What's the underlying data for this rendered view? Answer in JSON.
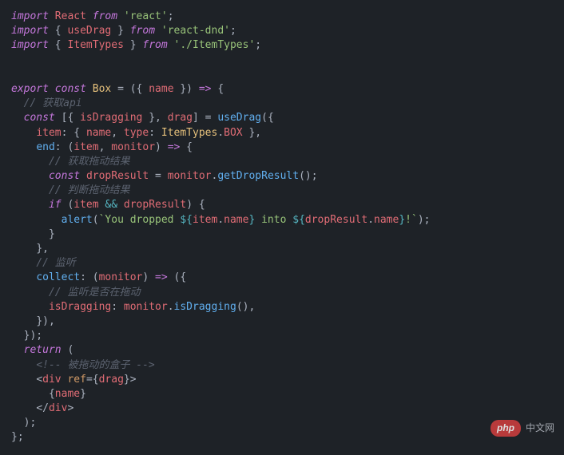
{
  "code": {
    "l1": {
      "kw1": "import",
      "name": "React",
      "kw2": "from",
      "str": "'react'",
      "end": ";"
    },
    "l2": {
      "kw1": "import",
      "br": "{ ",
      "name": "useDrag",
      "br2": " }",
      "kw2": "from",
      "str": "'react-dnd'",
      "end": ";"
    },
    "l3": {
      "kw1": "import",
      "br": "{ ",
      "name": "ItemTypes",
      "br2": " }",
      "kw2": "from",
      "str": "'./ItemTypes'",
      "end": ";"
    },
    "l4": {
      "txt": ""
    },
    "l5": {
      "txt": ""
    },
    "l6": {
      "kw1": "export",
      "kw2": "const",
      "type": "Box",
      "eq": " = ",
      "args": "({ ",
      "name": "name",
      "args2": " }) ",
      "arrow": "=>",
      "brace": " {"
    },
    "l7": {
      "com": "// 获取api"
    },
    "l8": {
      "kw": "const",
      "br": " [{ ",
      "p": "isDragging",
      "br2": " }, ",
      "p2": "drag",
      "br3": "] = ",
      "fn": "useDrag",
      "paren": "({"
    },
    "l9": {
      "p": "item",
      "colon": ": { ",
      "p2": "name",
      "comma": ", ",
      "p3": "type",
      "colon2": ": ",
      "type": "ItemTypes",
      "dot": ".",
      "prop": "BOX",
      "end": " },"
    },
    "l10": {
      "fn": "end",
      "colon": ": (",
      "a1": "item",
      "comma": ", ",
      "a2": "monitor",
      "paren": ") ",
      "arrow": "=>",
      "brace": " {"
    },
    "l11": {
      "com": "// 获取拖动结果"
    },
    "l12": {
      "kw": "const",
      "sp": " ",
      "name": "dropResult",
      "eq": " = ",
      "obj": "monitor",
      "dot": ".",
      "fn": "getDropResult",
      "paren": "();"
    },
    "l13": {
      "com": "// 判断拖动结果"
    },
    "l14": {
      "kw": "if",
      "sp": " (",
      "v1": "item",
      "op": " && ",
      "v2": "dropResult",
      "paren": ") {"
    },
    "l15": {
      "fn": "alert",
      "paren": "(",
      "s1": "`You dropped ",
      "d1": "${",
      "v1": "item",
      "dot": ".",
      "p1": "name",
      "d2": "}",
      "s2": " into ",
      "d3": "${",
      "v2": "dropResult",
      "dot2": ".",
      "p2": "name",
      "d4": "}",
      "s3": "!`",
      "paren2": ");"
    },
    "l16": {
      "brace": "}"
    },
    "l17": {
      "brace": "},"
    },
    "l18": {
      "com": "// 监听"
    },
    "l19": {
      "fn": "collect",
      "colon": ": (",
      "a": "monitor",
      "paren": ") ",
      "arrow": "=>",
      "brace": " ({"
    },
    "l20": {
      "com": "// 监听是否在拖动"
    },
    "l21": {
      "p": "isDragging",
      "colon": ": ",
      "obj": "monitor",
      "dot": ".",
      "fn": "isDragging",
      "paren": "(),"
    },
    "l22": {
      "brace": "}),"
    },
    "l23": {
      "brace": "});"
    },
    "l24": {
      "kw": "return",
      "paren": " ("
    },
    "l25": {
      "com": "<!-- 被拖动的盒子 -->"
    },
    "l26": {
      "lt": "<",
      "tag": "div",
      "sp": " ",
      "attr": "ref",
      "eq": "=",
      "brace": "{",
      "v": "drag",
      "brace2": "}",
      "gt": ">"
    },
    "l27": {
      "brace": "{",
      "v": "name",
      "brace2": "}"
    },
    "l28": {
      "lt": "</",
      "tag": "div",
      "gt": ">"
    },
    "l29": {
      "paren": ");"
    },
    "l30": {
      "brace": "};"
    }
  },
  "watermark": {
    "logo": "php",
    "txt": "中文网"
  }
}
